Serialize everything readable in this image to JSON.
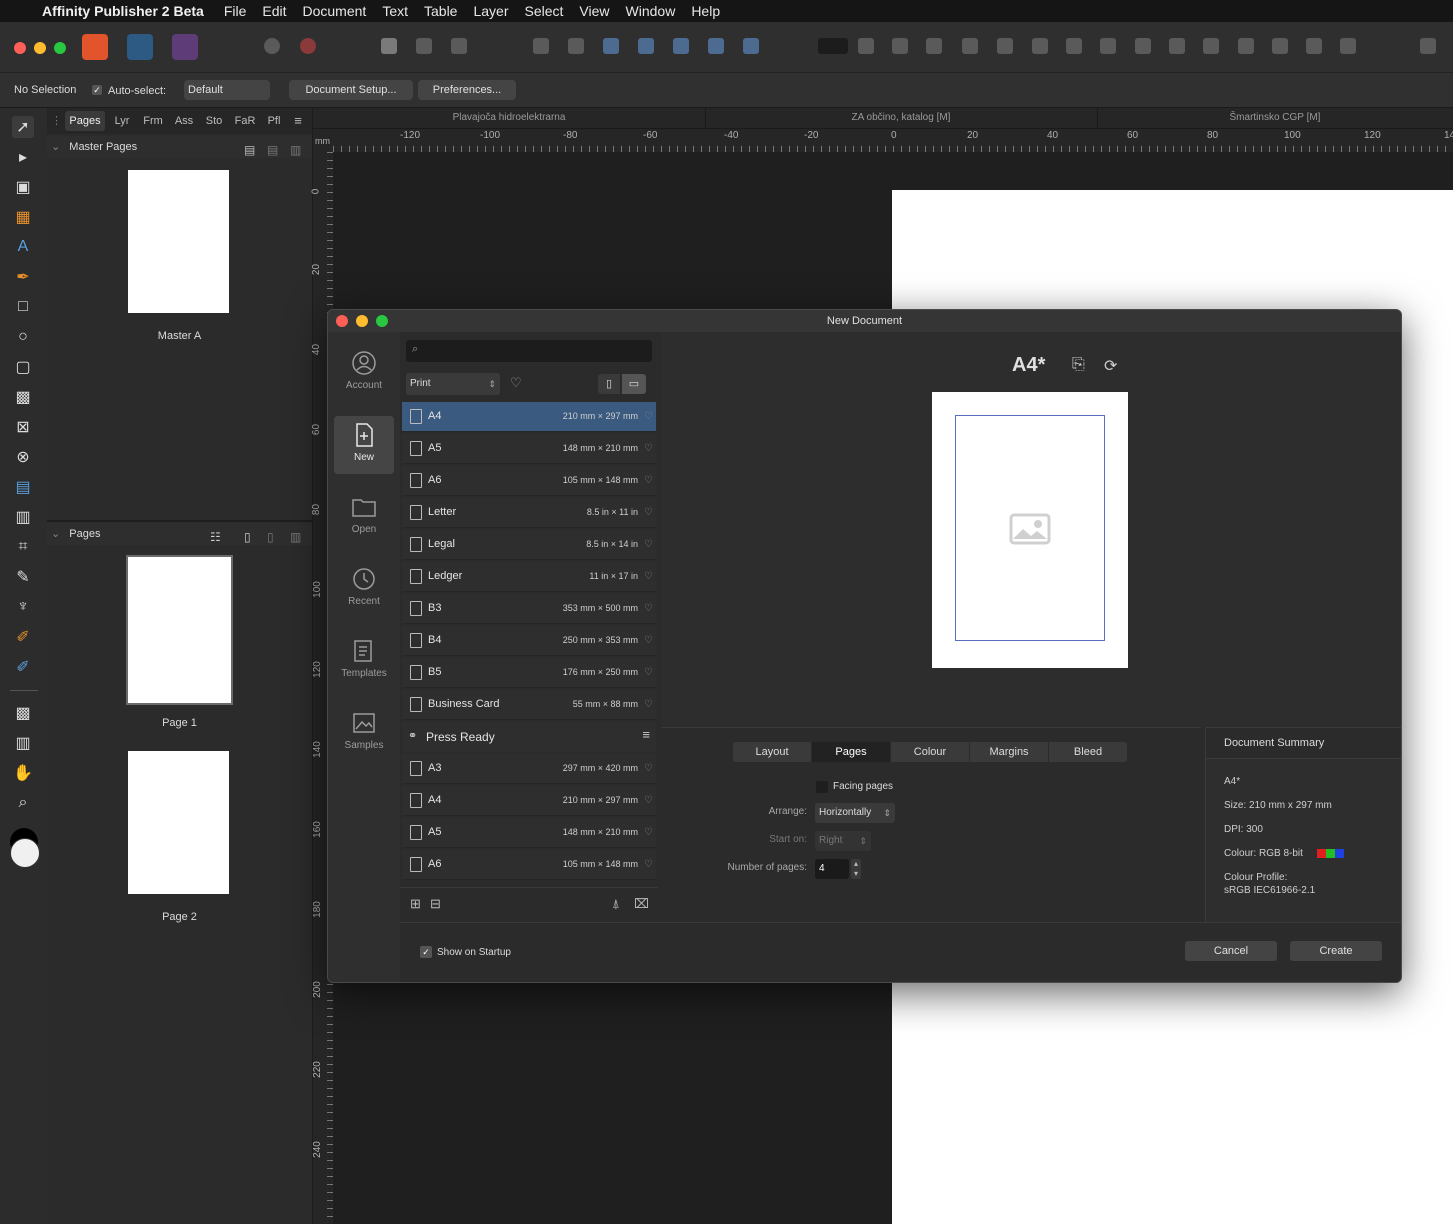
{
  "menubar": {
    "app_name": "Affinity Publisher 2 Beta",
    "items": [
      "File",
      "Edit",
      "Document",
      "Text",
      "Table",
      "Layer",
      "Select",
      "View",
      "Window",
      "Help"
    ]
  },
  "context_bar": {
    "selection": "No Selection",
    "auto_select_label": "Auto-select:",
    "auto_select_value": "Default",
    "document_setup": "Document Setup...",
    "preferences": "Preferences..."
  },
  "panel": {
    "tabs": [
      "Pages",
      "Lyr",
      "Frm",
      "Ass",
      "Sto",
      "FaR",
      "Pfl"
    ],
    "master_pages_title": "Master Pages",
    "master_label": "Master A",
    "pages_title": "Pages",
    "page_labels": [
      "Page 1",
      "Page 2"
    ]
  },
  "document_tabs": [
    "Plavajoča hidroelektrarna",
    "ZA občino, katalog [M]",
    "Šmartinsko CGP [M]"
  ],
  "ruler": {
    "unit": "mm",
    "h_ticks": [
      "-120",
      "-100",
      "-80",
      "-60",
      "-40",
      "-20",
      "0",
      "20",
      "40",
      "60",
      "80",
      "100",
      "120",
      "14"
    ],
    "v_ticks": [
      "0",
      "20",
      "40",
      "60",
      "80",
      "100",
      "120",
      "140",
      "160",
      "180",
      "200",
      "220",
      "240"
    ]
  },
  "dialog": {
    "title": "New Document",
    "nav": [
      "Account",
      "New",
      "Open",
      "Recent",
      "Templates",
      "Samples"
    ],
    "category": "Print",
    "presets": [
      {
        "name": "A4",
        "size": "210 mm × 297 mm"
      },
      {
        "name": "A5",
        "size": "148 mm × 210 mm"
      },
      {
        "name": "A6",
        "size": "105 mm × 148 mm"
      },
      {
        "name": "Letter",
        "size": "8.5 in × 11 in"
      },
      {
        "name": "Legal",
        "size": "8.5 in × 14 in"
      },
      {
        "name": "Ledger",
        "size": "11 in × 17 in"
      },
      {
        "name": "B3",
        "size": "353 mm × 500 mm"
      },
      {
        "name": "B4",
        "size": "250 mm × 353 mm"
      },
      {
        "name": "B5",
        "size": "176 mm × 250 mm"
      },
      {
        "name": "Business Card",
        "size": "55 mm × 88 mm"
      }
    ],
    "group_title": "Press Ready",
    "group_presets": [
      {
        "name": "A3",
        "size": "297 mm × 420 mm"
      },
      {
        "name": "A4",
        "size": "210 mm × 297 mm"
      },
      {
        "name": "A5",
        "size": "148 mm × 210 mm"
      },
      {
        "name": "A6",
        "size": "105 mm × 148 mm"
      }
    ],
    "preview_title": "A4*",
    "tabs": [
      "Layout",
      "Pages",
      "Colour",
      "Margins",
      "Bleed"
    ],
    "facing_pages": "Facing pages",
    "arrange_label": "Arrange:",
    "arrange_value": "Horizontally",
    "start_on_label": "Start on:",
    "start_on_value": "Right",
    "num_pages_label": "Number of pages:",
    "num_pages_value": "4",
    "summary": {
      "title": "Document Summary",
      "name": "A4*",
      "size": "Size: 210 mm x 297 mm",
      "dpi": "DPI:  300",
      "colour": "Colour: RGB 8-bit",
      "profile_label": "Colour Profile:",
      "profile_value": "sRGB IEC61966-2.1"
    },
    "show_on_startup": "Show on Startup",
    "cancel": "Cancel",
    "create": "Create"
  },
  "colors": {
    "selected": "#3b5a80",
    "close": "#fe5f57",
    "minimize": "#febc2e",
    "zoom": "#28c840"
  }
}
